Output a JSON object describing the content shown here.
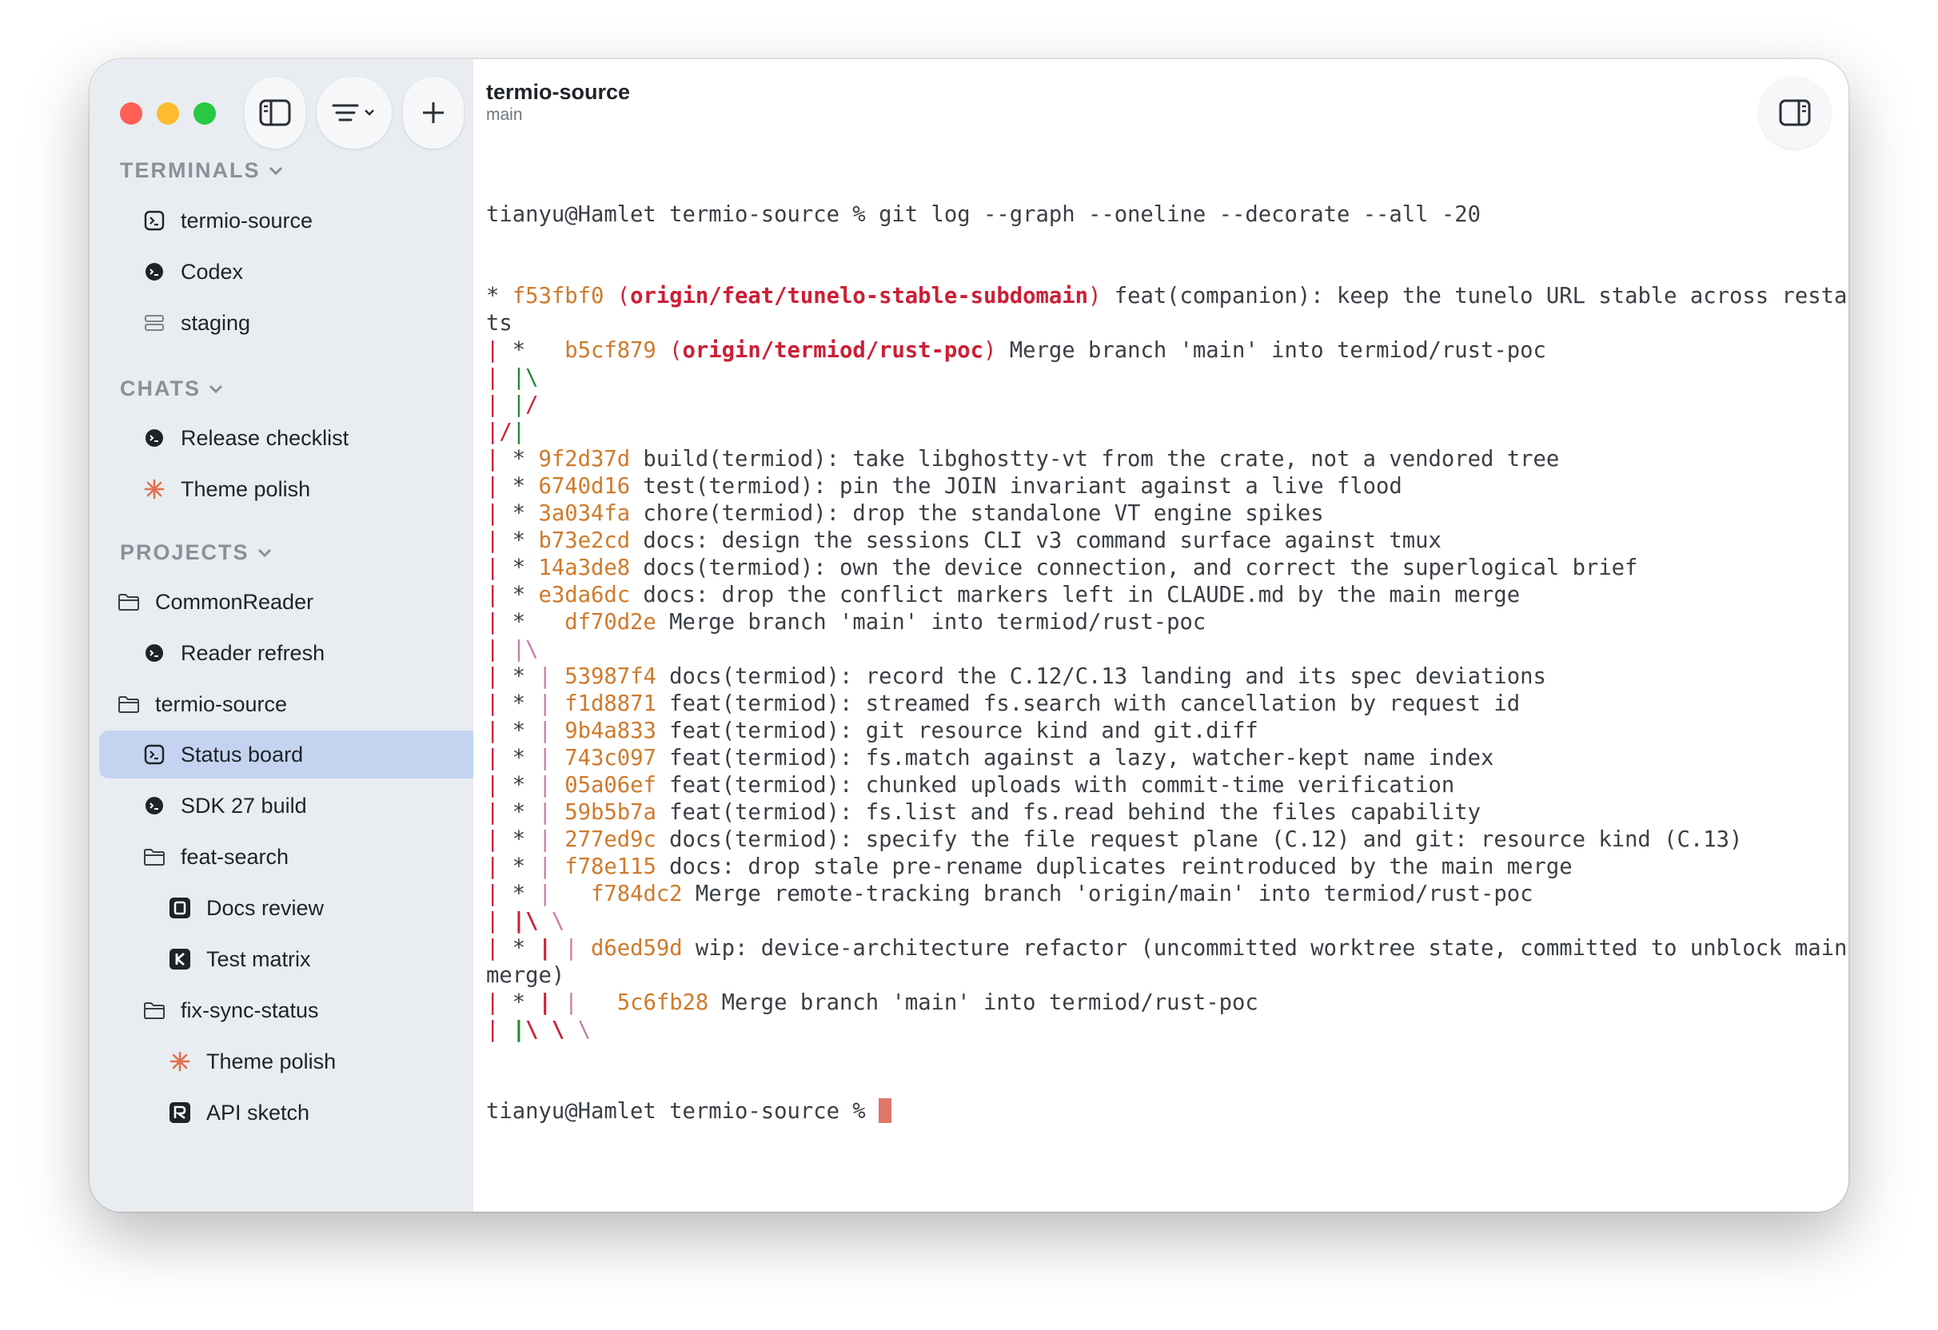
{
  "header": {
    "title": "termio-source",
    "subtitle": "main"
  },
  "sections": {
    "terminals": "TERMINALS",
    "chats": "CHATS",
    "projects": "PROJECTS"
  },
  "terminals": [
    "termio-source",
    "Codex",
    "staging"
  ],
  "chats": [
    "Release checklist",
    "Theme polish"
  ],
  "projects": {
    "common_reader": "CommonReader",
    "reader_refresh": "Reader refresh",
    "termio_source": "termio-source",
    "status_board": "Status board",
    "sdk_build": "SDK 27 build",
    "feat_search": "feat-search",
    "docs_review": "Docs review",
    "test_matrix": "Test matrix",
    "fix_sync_status": "fix-sync-status",
    "theme_polish": "Theme polish",
    "api_sketch": "API sketch"
  },
  "terminal": {
    "prompt": "tianyu@Hamlet termio-source % ",
    "command": "git log --graph --oneline --decorate --all -20",
    "lines": [
      [
        [
          "t",
          "* "
        ],
        [
          "y",
          "f53fbf0 "
        ],
        [
          "r",
          "("
        ],
        [
          "rb",
          "origin/feat/tunelo-stable-subdomain"
        ],
        [
          "r",
          ")"
        ],
        [
          "t",
          " feat(companion): keep the tunelo URL stable across restar"
        ]
      ],
      [
        [
          "t",
          "ts"
        ]
      ],
      [
        [
          "r",
          "|"
        ],
        [
          "t",
          " *   "
        ],
        [
          "y",
          "b5cf879 "
        ],
        [
          "r",
          "("
        ],
        [
          "rb",
          "origin/termiod/rust-poc"
        ],
        [
          "r",
          ")"
        ],
        [
          "t",
          " Merge branch 'main' into termiod/rust-poc"
        ]
      ],
      [
        [
          "r",
          "|"
        ],
        [
          "t",
          " "
        ],
        [
          "g",
          "|\\"
        ]
      ],
      [
        [
          "r",
          "|"
        ],
        [
          "t",
          " "
        ],
        [
          "g",
          "|"
        ],
        [
          "r",
          "/"
        ]
      ],
      [
        [
          "r",
          "|/"
        ],
        [
          "g",
          "|"
        ]
      ],
      [
        [
          "r",
          "|"
        ],
        [
          "t",
          " * "
        ],
        [
          "y",
          "9f2d37d"
        ],
        [
          "t",
          " build(termiod): take libghostty-vt from the crate, not a vendored tree"
        ]
      ],
      [
        [
          "r",
          "|"
        ],
        [
          "t",
          " * "
        ],
        [
          "y",
          "6740d16"
        ],
        [
          "t",
          " test(termiod): pin the JOIN invariant against a live flood"
        ]
      ],
      [
        [
          "r",
          "|"
        ],
        [
          "t",
          " * "
        ],
        [
          "y",
          "3a034fa"
        ],
        [
          "t",
          " chore(termiod): drop the standalone VT engine spikes"
        ]
      ],
      [
        [
          "r",
          "|"
        ],
        [
          "t",
          " * "
        ],
        [
          "y",
          "b73e2cd"
        ],
        [
          "t",
          " docs: design the sessions CLI v3 command surface against tmux"
        ]
      ],
      [
        [
          "r",
          "|"
        ],
        [
          "t",
          " * "
        ],
        [
          "y",
          "14a3de8"
        ],
        [
          "t",
          " docs(termiod): own the device connection, and correct the superlogical brief"
        ]
      ],
      [
        [
          "r",
          "|"
        ],
        [
          "t",
          " * "
        ],
        [
          "y",
          "e3da6dc"
        ],
        [
          "t",
          " docs: drop the conflict markers left in CLAUDE.md by the main merge"
        ]
      ],
      [
        [
          "r",
          "|"
        ],
        [
          "t",
          " *   "
        ],
        [
          "y",
          "df70d2e"
        ],
        [
          "t",
          " Merge branch 'main' into termiod/rust-poc"
        ]
      ],
      [
        [
          "r",
          "|"
        ],
        [
          "t",
          " "
        ],
        [
          "p",
          "|\\"
        ]
      ],
      [
        [
          "r",
          "|"
        ],
        [
          "t",
          " * "
        ],
        [
          "p",
          "|"
        ],
        [
          "t",
          " "
        ],
        [
          "y",
          "53987f4"
        ],
        [
          "t",
          " docs(termiod): record the C.12/C.13 landing and its spec deviations"
        ]
      ],
      [
        [
          "r",
          "|"
        ],
        [
          "t",
          " * "
        ],
        [
          "p",
          "|"
        ],
        [
          "t",
          " "
        ],
        [
          "y",
          "f1d8871"
        ],
        [
          "t",
          " feat(termiod): streamed fs.search with cancellation by request id"
        ]
      ],
      [
        [
          "r",
          "|"
        ],
        [
          "t",
          " * "
        ],
        [
          "p",
          "|"
        ],
        [
          "t",
          " "
        ],
        [
          "y",
          "9b4a833"
        ],
        [
          "t",
          " feat(termiod): git resource kind and git.diff"
        ]
      ],
      [
        [
          "r",
          "|"
        ],
        [
          "t",
          " * "
        ],
        [
          "p",
          "|"
        ],
        [
          "t",
          " "
        ],
        [
          "y",
          "743c097"
        ],
        [
          "t",
          " feat(termiod): fs.match against a lazy, watcher-kept name index"
        ]
      ],
      [
        [
          "r",
          "|"
        ],
        [
          "t",
          " * "
        ],
        [
          "p",
          "|"
        ],
        [
          "t",
          " "
        ],
        [
          "y",
          "05a06ef"
        ],
        [
          "t",
          " feat(termiod): chunked uploads with commit-time verification"
        ]
      ],
      [
        [
          "r",
          "|"
        ],
        [
          "t",
          " * "
        ],
        [
          "p",
          "|"
        ],
        [
          "t",
          " "
        ],
        [
          "y",
          "59b5b7a"
        ],
        [
          "t",
          " feat(termiod): fs.list and fs.read behind the files capability"
        ]
      ],
      [
        [
          "r",
          "|"
        ],
        [
          "t",
          " * "
        ],
        [
          "p",
          "|"
        ],
        [
          "t",
          " "
        ],
        [
          "y",
          "277ed9c"
        ],
        [
          "t",
          " docs(termiod): specify the file request plane (C.12) and git: resource kind (C.13)"
        ]
      ],
      [
        [
          "r",
          "|"
        ],
        [
          "t",
          " * "
        ],
        [
          "p",
          "|"
        ],
        [
          "t",
          " "
        ],
        [
          "y",
          "f78e115"
        ],
        [
          "t",
          " docs: drop stale pre-rename duplicates reintroduced by the main merge"
        ]
      ],
      [
        [
          "r",
          "|"
        ],
        [
          "t",
          " * "
        ],
        [
          "p",
          "|"
        ],
        [
          "t",
          "   "
        ],
        [
          "y",
          "f784dc2"
        ],
        [
          "t",
          " Merge remote-tracking branch 'origin/main' into termiod/rust-poc"
        ]
      ],
      [
        [
          "r",
          "|"
        ],
        [
          "t",
          " "
        ],
        [
          "rb",
          "|\\"
        ],
        [
          "t",
          " "
        ],
        [
          "p",
          "\\"
        ]
      ],
      [
        [
          "r",
          "|"
        ],
        [
          "t",
          " * "
        ],
        [
          "rb",
          "|"
        ],
        [
          "t",
          " "
        ],
        [
          "p",
          "|"
        ],
        [
          "t",
          " "
        ],
        [
          "y",
          "d6ed59d"
        ],
        [
          "t",
          " wip: device-architecture refactor (uncommitted worktree state, committed to unblock main"
        ]
      ],
      [
        [
          "t",
          "merge)"
        ]
      ],
      [
        [
          "r",
          "|"
        ],
        [
          "t",
          " * "
        ],
        [
          "rb",
          "|"
        ],
        [
          "t",
          " "
        ],
        [
          "p",
          "|"
        ],
        [
          "t",
          "   "
        ],
        [
          "y",
          "5c6fb28"
        ],
        [
          "t",
          " Merge branch 'main' into termiod/rust-poc"
        ]
      ],
      [
        [
          "r",
          "|"
        ],
        [
          "t",
          " "
        ],
        [
          "gb",
          "|"
        ],
        [
          "rb",
          "\\"
        ],
        [
          "t",
          " "
        ],
        [
          "rb",
          "\\"
        ],
        [
          "t",
          " "
        ],
        [
          "p",
          "\\"
        ]
      ]
    ]
  },
  "colors": {
    "accent_selected": "#c4d4f0",
    "hash": "#cf7a2b",
    "ref": "#cc1f36",
    "graph_green": "#1f8a2f",
    "graph_pink": "#c97aa8",
    "cursor": "#e07766"
  },
  "icons": {
    "sidebar_toggle": "sidebar-left-icon",
    "filter": "filter-lines-icon",
    "new": "plus-icon",
    "right_panel": "sidebar-right-icon",
    "terminal": "terminal-icon",
    "codex": "codex-icon",
    "server": "server-icon",
    "sparkle": "sparkle-icon",
    "folder": "folder-icon",
    "branch": "branch-icon"
  }
}
